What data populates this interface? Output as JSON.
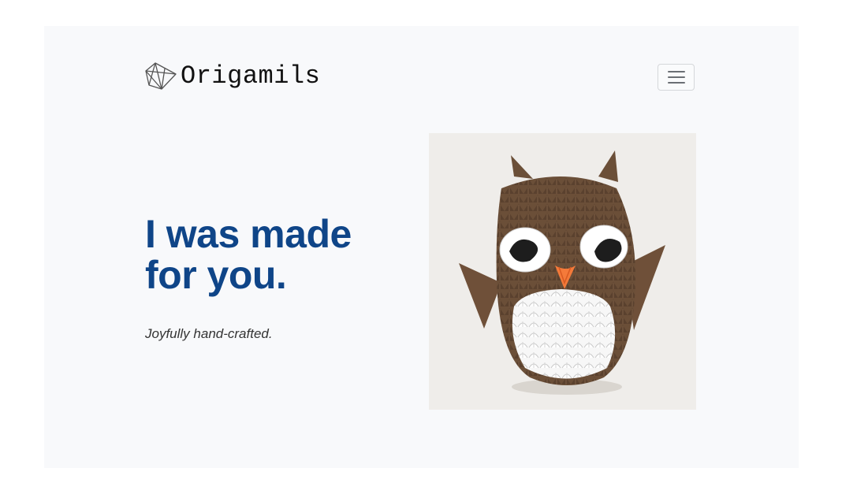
{
  "header": {
    "brand_name": "Origamils",
    "logo_icon": "origami-gem-icon",
    "menu_icon": "hamburger-menu-icon"
  },
  "hero": {
    "headline": "I was made for you.",
    "tagline": "Joyfully hand-crafted.",
    "image": "origami-owl-photo"
  },
  "colors": {
    "headline": "#0f4588",
    "panel_background": "#f8f9fb",
    "image_background": "#efedea",
    "owl_brown": "#6b4f38",
    "owl_white": "#ffffff",
    "owl_beak": "#f47a3a"
  }
}
